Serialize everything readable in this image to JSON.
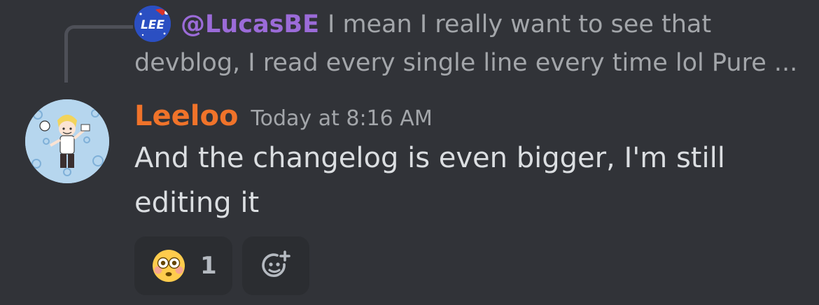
{
  "reply": {
    "avatar_label": "LEE",
    "username": "@LucasBE",
    "text_line1": "I mean I really want to see that",
    "text_line2": "devblog, I read every single line every time lol Pure ..."
  },
  "message": {
    "author": "Leeloo",
    "timestamp": "Today at 8:16 AM",
    "content": "And the changelog is even bigger, I'm still editing it"
  },
  "reactions": [
    {
      "emoji_icon": "flushed-face-icon",
      "count": "1"
    }
  ],
  "add_reaction_icon": "add-reaction-icon",
  "colors": {
    "background": "#313338",
    "author": "#f0732a",
    "reply_username": "#9b6bd8",
    "muted_text": "#a3a6aa",
    "body_text": "#dbdee1",
    "reaction_bg": "#2b2d31"
  }
}
